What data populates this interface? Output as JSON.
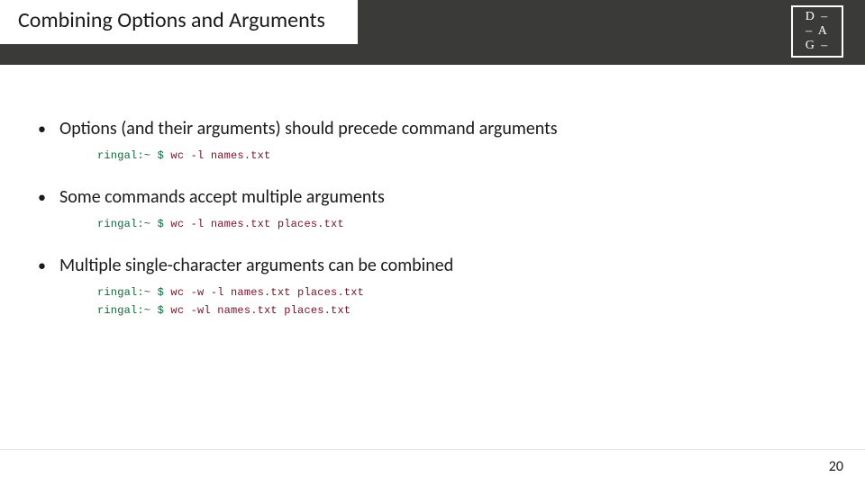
{
  "title": "Combining Options and Arguments",
  "logo": {
    "row1": "D –",
    "row2": "– A",
    "row3": "G –"
  },
  "bullets": [
    {
      "text": "Options (and their arguments) should precede command arguments",
      "code": [
        {
          "prompt": "ringal:~ $",
          "cmd": " wc -l names.txt"
        }
      ]
    },
    {
      "text": "Some commands accept multiple arguments",
      "code": [
        {
          "prompt": "ringal:~ $",
          "cmd": " wc -l names.txt places.txt"
        }
      ]
    },
    {
      "text": "Multiple single-character arguments can be combined",
      "code": [
        {
          "prompt": "ringal:~ $",
          "cmd": " wc -w -l names.txt places.txt"
        },
        {
          "prompt": "ringal:~ $",
          "cmd": " wc -wl names.txt places.txt"
        }
      ]
    }
  ],
  "page_number": "20"
}
